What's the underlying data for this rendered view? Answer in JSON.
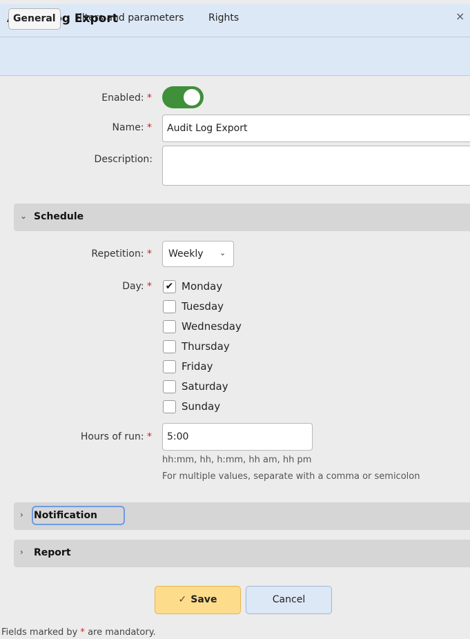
{
  "window": {
    "title": "Audit Log Export",
    "close_glyph": "×"
  },
  "tabs": [
    {
      "label": "General",
      "active": true
    },
    {
      "label": "Filters and parameters",
      "active": false
    },
    {
      "label": "Rights",
      "active": false
    }
  ],
  "required_mark": "*",
  "general": {
    "enabled_label": "Enabled:",
    "enabled_value": true,
    "name_label": "Name:",
    "name_value": "Audit Log Export",
    "description_label": "Description:",
    "description_value": ""
  },
  "schedule": {
    "section_title": "Schedule",
    "expanded": true,
    "repetition_label": "Repetition:",
    "repetition_value": "Weekly",
    "day_label": "Day:",
    "days": [
      {
        "label": "Monday",
        "checked": true
      },
      {
        "label": "Tuesday",
        "checked": false
      },
      {
        "label": "Wednesday",
        "checked": false
      },
      {
        "label": "Thursday",
        "checked": false
      },
      {
        "label": "Friday",
        "checked": false
      },
      {
        "label": "Saturday",
        "checked": false
      },
      {
        "label": "Sunday",
        "checked": false
      }
    ],
    "hours_label": "Hours of run:",
    "hours_value": "5:00",
    "hours_hint_1": "hh:mm, hh, h:mm, hh am, hh pm",
    "hours_hint_2": "For multiple values, separate with a comma or semicolon"
  },
  "notification": {
    "section_title": "Notification",
    "expanded": false
  },
  "report": {
    "section_title": "Report",
    "expanded": false
  },
  "buttons": {
    "save_label": "Save",
    "save_icon": "✓",
    "cancel_label": "Cancel"
  },
  "footer": {
    "note_prefix": "Fields marked by",
    "note_mark": "*",
    "note_suffix": "are mandatory."
  },
  "icons": {
    "collapsed": "›",
    "expanded": "⌄",
    "checkmark": "✔",
    "select_chevron": "⌄"
  },
  "colors": {
    "toggle_on": "#3f8f3b",
    "save_bg": "#fddc8c",
    "header_bg": "#dde8f7",
    "required": "#cc2222"
  }
}
